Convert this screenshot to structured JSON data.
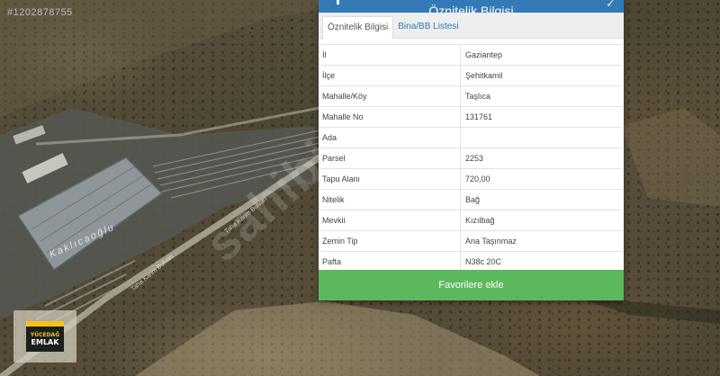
{
  "map": {
    "listing_id": "#1202878755",
    "watermark": "sahibi",
    "place_label": "Kaklıcaoğlu",
    "road_label_1": "Taha Karim Bulvarı",
    "road_label_2": "Taha Karim Bulvarı"
  },
  "logo": {
    "line1": "YÜCEDAĞ",
    "line2": "EMLAK"
  },
  "panel": {
    "title": "Öznitelik Bilgisi",
    "tabs": [
      {
        "label": "Öznitelik Bilgisi",
        "active": true
      },
      {
        "label": "Bina/BB Listesi",
        "active": false
      }
    ],
    "rows": [
      {
        "label": "İl",
        "value": "Gaziantep"
      },
      {
        "label": "İlçe",
        "value": "Şehitkamil"
      },
      {
        "label": "Mahalle/Köy",
        "value": "Taşlıca"
      },
      {
        "label": "Mahalle No",
        "value": "131761"
      },
      {
        "label": "Ada",
        "value": ""
      },
      {
        "label": "Parsel",
        "value": "2253"
      },
      {
        "label": "Tapu Alanı",
        "value": "720,00"
      },
      {
        "label": "Nitelik",
        "value": "Bağ"
      },
      {
        "label": "Mevkii",
        "value": "Kızılbağ"
      },
      {
        "label": "Zemin Tip",
        "value": "Ana Taşınmaz"
      },
      {
        "label": "Pafta",
        "value": "N38c 20C"
      }
    ],
    "favorite_button": "Favorilere ekle"
  },
  "colors": {
    "header_blue": "#337ab7",
    "button_green": "#5cb85c",
    "tab_link": "#337ab7"
  }
}
